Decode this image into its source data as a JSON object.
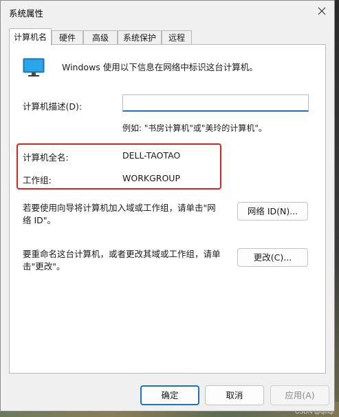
{
  "window": {
    "title": "系统属性"
  },
  "tabs": [
    {
      "label": "计算机名",
      "active": true
    },
    {
      "label": "硬件",
      "active": false
    },
    {
      "label": "高级",
      "active": false
    },
    {
      "label": "系统保护",
      "active": false
    },
    {
      "label": "远程",
      "active": false
    }
  ],
  "computer_name_tab": {
    "intro": "Windows 使用以下信息在网络中标识这台计算机。",
    "description_label": "计算机描述(D):",
    "description_value": "",
    "example": "例如: \"书房计算机\"或\"美玲的计算机\"。",
    "full_name_label": "计算机全名:",
    "full_name_value": "DELL-TAOTAO",
    "workgroup_label": "工作组:",
    "workgroup_value": "WORKGROUP",
    "network_id_text": "若要使用向导将计算机加入域或工作组，请单击\"网络 ID\"。",
    "network_id_button": "网络 ID(N)...",
    "change_text": "要重命名这台计算机，或者更改其域或工作组，请单击\"更改\"。",
    "change_button": "更改(C)..."
  },
  "footer": {
    "ok": "确定",
    "cancel": "取消",
    "apply": "应用(A)"
  },
  "watermark": "CSDN @qinqi",
  "colors": {
    "accent": "#1a73c8",
    "highlight_box": "#e02020",
    "monitor": "#1e8fd6"
  },
  "icons": [
    "monitor-icon",
    "close-icon"
  ]
}
